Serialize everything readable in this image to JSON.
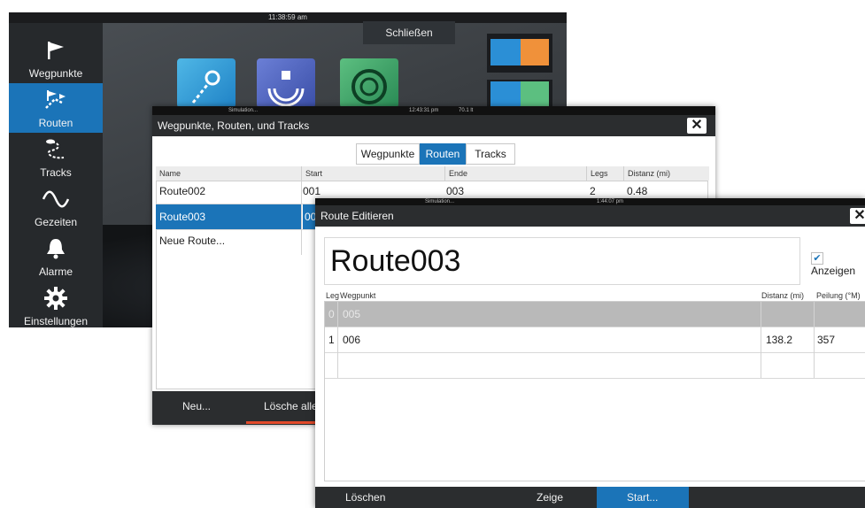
{
  "home": {
    "clock": "11:38:59 am",
    "close_label": "Schließen",
    "sidebar": [
      {
        "label": "Wegpunkte",
        "icon": "flag-icon",
        "active": false
      },
      {
        "label": "Routen",
        "icon": "route-icon",
        "active": true
      },
      {
        "label": "Tracks",
        "icon": "track-icon",
        "active": false
      },
      {
        "label": "Gezeiten",
        "icon": "tide-icon",
        "active": false
      },
      {
        "label": "Alarme",
        "icon": "bell-icon",
        "active": false
      },
      {
        "label": "Einstellungen",
        "icon": "gear-icon",
        "active": false
      }
    ]
  },
  "wrt": {
    "status_left": "Simulation...",
    "status_time": "12:43:31 pm",
    "status_right": "70.1 lt",
    "title": "Wegpunkte, Routen, und Tracks",
    "tabs": [
      "Wegpunkte",
      "Routen",
      "Tracks"
    ],
    "active_tab": "Routen",
    "columns": [
      "Name",
      "Start",
      "Ende",
      "Legs",
      "Distanz (mi)"
    ],
    "rows": [
      {
        "name": "Route002",
        "start": "001",
        "ende": "003",
        "legs": "2",
        "distanz": "0.48"
      },
      {
        "name": "Route003",
        "start": "00",
        "ende": "",
        "legs": "",
        "distanz": ""
      },
      {
        "name": "Neue Route...",
        "start": "",
        "ende": "",
        "legs": "",
        "distanz": ""
      }
    ],
    "buttons": {
      "new": "Neu...",
      "delete_all": "Lösche alle"
    }
  },
  "edit": {
    "status_left": "Simulation...",
    "status_time": "1:44:07 pm",
    "title": "Route Editieren",
    "route_name": "Route003",
    "show_label": "Anzeigen",
    "show_checked": true,
    "columns": [
      "Leg",
      "Wegpunkt",
      "Distanz (mi)",
      "Peilung (°M)"
    ],
    "rows": [
      {
        "leg": "0",
        "wegpunkt": "005",
        "distanz": "",
        "peilung": ""
      },
      {
        "leg": "1",
        "wegpunkt": "006",
        "distanz": "138.2",
        "peilung": "357"
      }
    ],
    "buttons": {
      "delete": "Löschen",
      "show": "Zeige",
      "start": "Start..."
    }
  },
  "colors": {
    "accent": "#1b74b8",
    "dark_bar": "#2b2d2f",
    "delete_red": "#e24a2a"
  }
}
